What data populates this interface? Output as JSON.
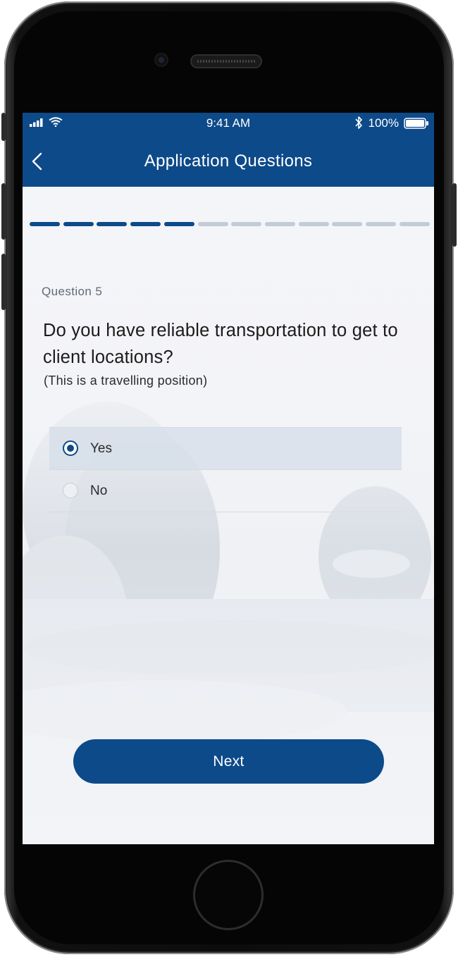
{
  "status_bar": {
    "time": "9:41 AM",
    "battery": "100%",
    "icons": [
      "cellular-signal-icon",
      "wifi-icon",
      "bluetooth-icon",
      "battery-icon"
    ]
  },
  "nav": {
    "title": "Application Questions",
    "back_icon": "chevron-left-icon"
  },
  "progress": {
    "completed_steps": 5,
    "total_steps": 12
  },
  "question": {
    "number_label": "Question 5",
    "text": "Do you have reliable transportation to get to client locations?",
    "note": "(This is a travelling position)"
  },
  "options": [
    {
      "label": "Yes",
      "selected": true
    },
    {
      "label": "No",
      "selected": false
    }
  ],
  "next_label": "Next",
  "colors": {
    "primary": "#0d4a8a",
    "progress_inactive": "#c2ccd8",
    "background": "#f3f4f7"
  }
}
